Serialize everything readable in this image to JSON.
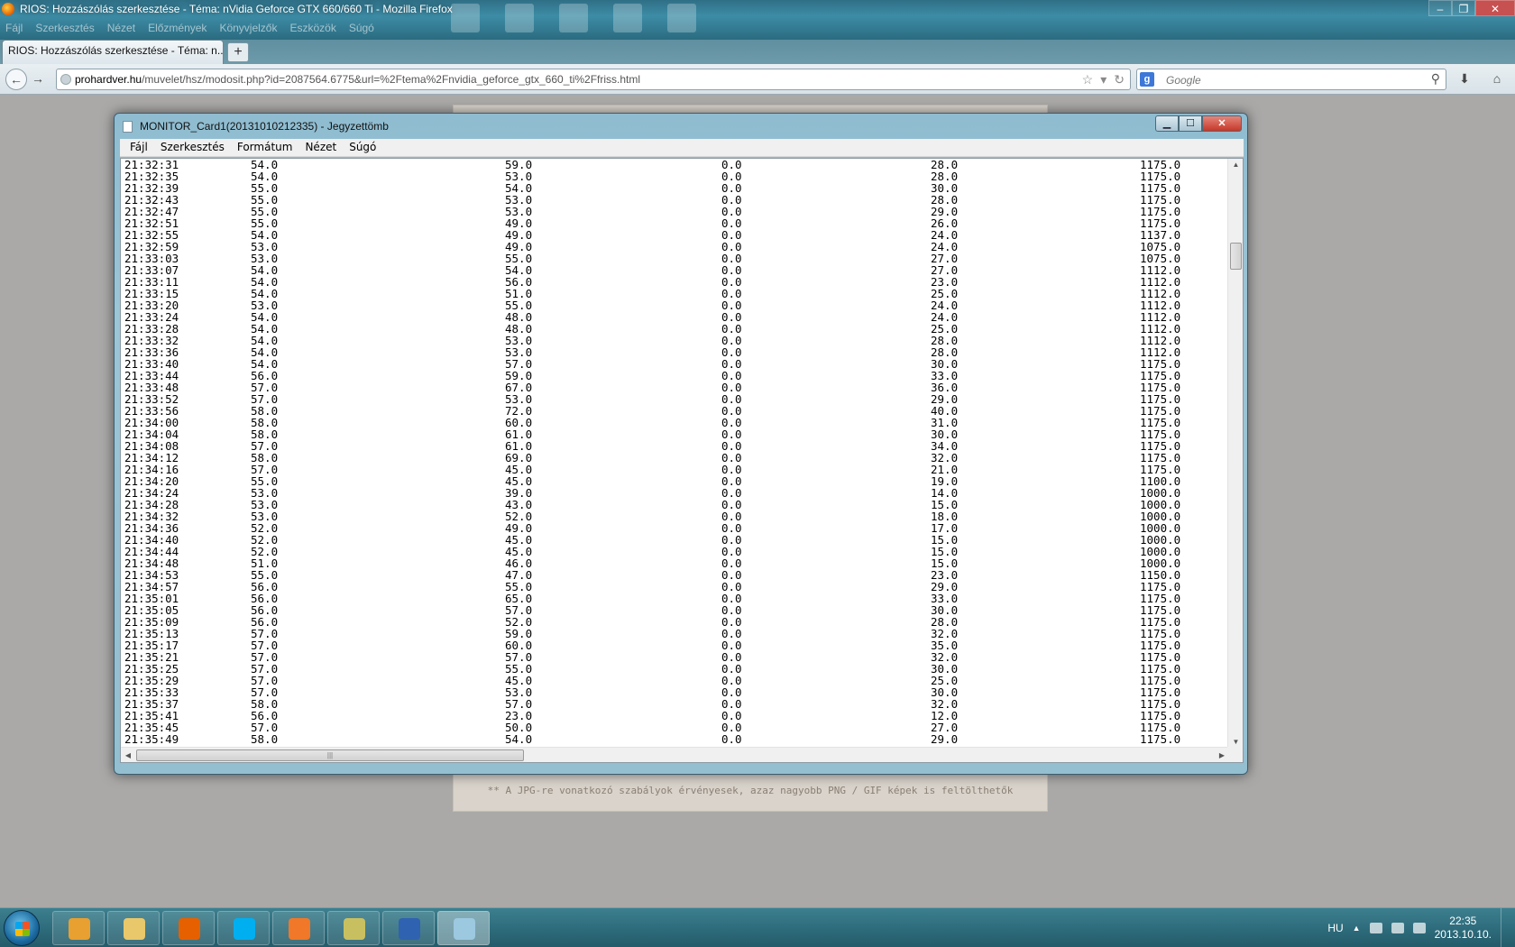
{
  "firefox": {
    "window_title": "RIOS: Hozzászólás szerkesztése - Téma: nVidia Geforce GTX 660/660 Ti - Mozilla Firefox",
    "menu": [
      "Fájl",
      "Szerkesztés",
      "Nézet",
      "Előzmények",
      "Könyvjelzők",
      "Eszközök",
      "Súgó"
    ],
    "tab_title": "RIOS: Hozzászólás szerkesztése - Téma: n...",
    "url_host": "prohardver.hu",
    "url_rest": "/muvelet/hsz/modosit.php?id=2087564.6775&url=%2Ftema%2Fnvidia_geforce_gtx_660_ti%2Ffriss.html",
    "search_placeholder": "Google",
    "search_engine_letter": "g"
  },
  "page_note": "** A JPG-re vonatkozó szabályok érvényesek, azaz nagyobb PNG / GIF képek is feltölthetők",
  "notepad": {
    "title": "MONITOR_Card1(20131010212335) - Jegyzettömb",
    "menu": [
      "Fájl",
      "Szerkesztés",
      "Formátum",
      "Nézet",
      "Súgó"
    ],
    "rows": [
      [
        "21:32:31",
        "54.0",
        "59.0",
        "0.0",
        "28.0",
        "1175.0"
      ],
      [
        "21:32:35",
        "54.0",
        "53.0",
        "0.0",
        "28.0",
        "1175.0"
      ],
      [
        "21:32:39",
        "55.0",
        "54.0",
        "0.0",
        "30.0",
        "1175.0"
      ],
      [
        "21:32:43",
        "55.0",
        "53.0",
        "0.0",
        "28.0",
        "1175.0"
      ],
      [
        "21:32:47",
        "55.0",
        "53.0",
        "0.0",
        "29.0",
        "1175.0"
      ],
      [
        "21:32:51",
        "55.0",
        "49.0",
        "0.0",
        "26.0",
        "1175.0"
      ],
      [
        "21:32:55",
        "54.0",
        "49.0",
        "0.0",
        "24.0",
        "1137.0"
      ],
      [
        "21:32:59",
        "53.0",
        "49.0",
        "0.0",
        "24.0",
        "1075.0"
      ],
      [
        "21:33:03",
        "53.0",
        "55.0",
        "0.0",
        "27.0",
        "1075.0"
      ],
      [
        "21:33:07",
        "54.0",
        "54.0",
        "0.0",
        "27.0",
        "1112.0"
      ],
      [
        "21:33:11",
        "54.0",
        "56.0",
        "0.0",
        "23.0",
        "1112.0"
      ],
      [
        "21:33:15",
        "54.0",
        "51.0",
        "0.0",
        "25.0",
        "1112.0"
      ],
      [
        "21:33:20",
        "53.0",
        "55.0",
        "0.0",
        "24.0",
        "1112.0"
      ],
      [
        "21:33:24",
        "54.0",
        "48.0",
        "0.0",
        "24.0",
        "1112.0"
      ],
      [
        "21:33:28",
        "54.0",
        "48.0",
        "0.0",
        "25.0",
        "1112.0"
      ],
      [
        "21:33:32",
        "54.0",
        "53.0",
        "0.0",
        "28.0",
        "1112.0"
      ],
      [
        "21:33:36",
        "54.0",
        "53.0",
        "0.0",
        "28.0",
        "1112.0"
      ],
      [
        "21:33:40",
        "54.0",
        "57.0",
        "0.0",
        "30.0",
        "1175.0"
      ],
      [
        "21:33:44",
        "56.0",
        "59.0",
        "0.0",
        "33.0",
        "1175.0"
      ],
      [
        "21:33:48",
        "57.0",
        "67.0",
        "0.0",
        "36.0",
        "1175.0"
      ],
      [
        "21:33:52",
        "57.0",
        "53.0",
        "0.0",
        "29.0",
        "1175.0"
      ],
      [
        "21:33:56",
        "58.0",
        "72.0",
        "0.0",
        "40.0",
        "1175.0"
      ],
      [
        "21:34:00",
        "58.0",
        "60.0",
        "0.0",
        "31.0",
        "1175.0"
      ],
      [
        "21:34:04",
        "58.0",
        "61.0",
        "0.0",
        "30.0",
        "1175.0"
      ],
      [
        "21:34:08",
        "57.0",
        "61.0",
        "0.0",
        "34.0",
        "1175.0"
      ],
      [
        "21:34:12",
        "58.0",
        "69.0",
        "0.0",
        "32.0",
        "1175.0"
      ],
      [
        "21:34:16",
        "57.0",
        "45.0",
        "0.0",
        "21.0",
        "1175.0"
      ],
      [
        "21:34:20",
        "55.0",
        "45.0",
        "0.0",
        "19.0",
        "1100.0"
      ],
      [
        "21:34:24",
        "53.0",
        "39.0",
        "0.0",
        "14.0",
        "1000.0"
      ],
      [
        "21:34:28",
        "53.0",
        "43.0",
        "0.0",
        "15.0",
        "1000.0"
      ],
      [
        "21:34:32",
        "53.0",
        "52.0",
        "0.0",
        "18.0",
        "1000.0"
      ],
      [
        "21:34:36",
        "52.0",
        "49.0",
        "0.0",
        "17.0",
        "1000.0"
      ],
      [
        "21:34:40",
        "52.0",
        "45.0",
        "0.0",
        "15.0",
        "1000.0"
      ],
      [
        "21:34:44",
        "52.0",
        "45.0",
        "0.0",
        "15.0",
        "1000.0"
      ],
      [
        "21:34:48",
        "51.0",
        "46.0",
        "0.0",
        "15.0",
        "1000.0"
      ],
      [
        "21:34:53",
        "55.0",
        "47.0",
        "0.0",
        "23.0",
        "1150.0"
      ],
      [
        "21:34:57",
        "56.0",
        "55.0",
        "0.0",
        "29.0",
        "1175.0"
      ],
      [
        "21:35:01",
        "56.0",
        "65.0",
        "0.0",
        "33.0",
        "1175.0"
      ],
      [
        "21:35:05",
        "56.0",
        "57.0",
        "0.0",
        "30.0",
        "1175.0"
      ],
      [
        "21:35:09",
        "56.0",
        "52.0",
        "0.0",
        "28.0",
        "1175.0"
      ],
      [
        "21:35:13",
        "57.0",
        "59.0",
        "0.0",
        "32.0",
        "1175.0"
      ],
      [
        "21:35:17",
        "57.0",
        "60.0",
        "0.0",
        "35.0",
        "1175.0"
      ],
      [
        "21:35:21",
        "57.0",
        "57.0",
        "0.0",
        "32.0",
        "1175.0"
      ],
      [
        "21:35:25",
        "57.0",
        "55.0",
        "0.0",
        "30.0",
        "1175.0"
      ],
      [
        "21:35:29",
        "57.0",
        "45.0",
        "0.0",
        "25.0",
        "1175.0"
      ],
      [
        "21:35:33",
        "57.0",
        "53.0",
        "0.0",
        "30.0",
        "1175.0"
      ],
      [
        "21:35:37",
        "58.0",
        "57.0",
        "0.0",
        "32.0",
        "1175.0"
      ],
      [
        "21:35:41",
        "56.0",
        "23.0",
        "0.0",
        "12.0",
        "1175.0"
      ],
      [
        "21:35:45",
        "57.0",
        "50.0",
        "0.0",
        "27.0",
        "1175.0"
      ],
      [
        "21:35:49",
        "58.0",
        "54.0",
        "0.0",
        "29.0",
        "1175.0"
      ]
    ]
  },
  "taskbar": {
    "language": "HU",
    "time": "22:35",
    "date": "2013.10.10.",
    "apps": [
      {
        "name": "media-player-icon",
        "color": "#e8a030"
      },
      {
        "name": "explorer-icon",
        "color": "#e8c86a"
      },
      {
        "name": "firefox-icon",
        "color": "#e66000"
      },
      {
        "name": "skype-icon",
        "color": "#00aff0"
      },
      {
        "name": "app-orange-icon",
        "color": "#f07828"
      },
      {
        "name": "gpu-tool-icon",
        "color": "#c8c060"
      },
      {
        "name": "save-disk-icon",
        "color": "#2f62b0"
      },
      {
        "name": "notepad-icon",
        "color": "#9cc8e0"
      }
    ]
  }
}
